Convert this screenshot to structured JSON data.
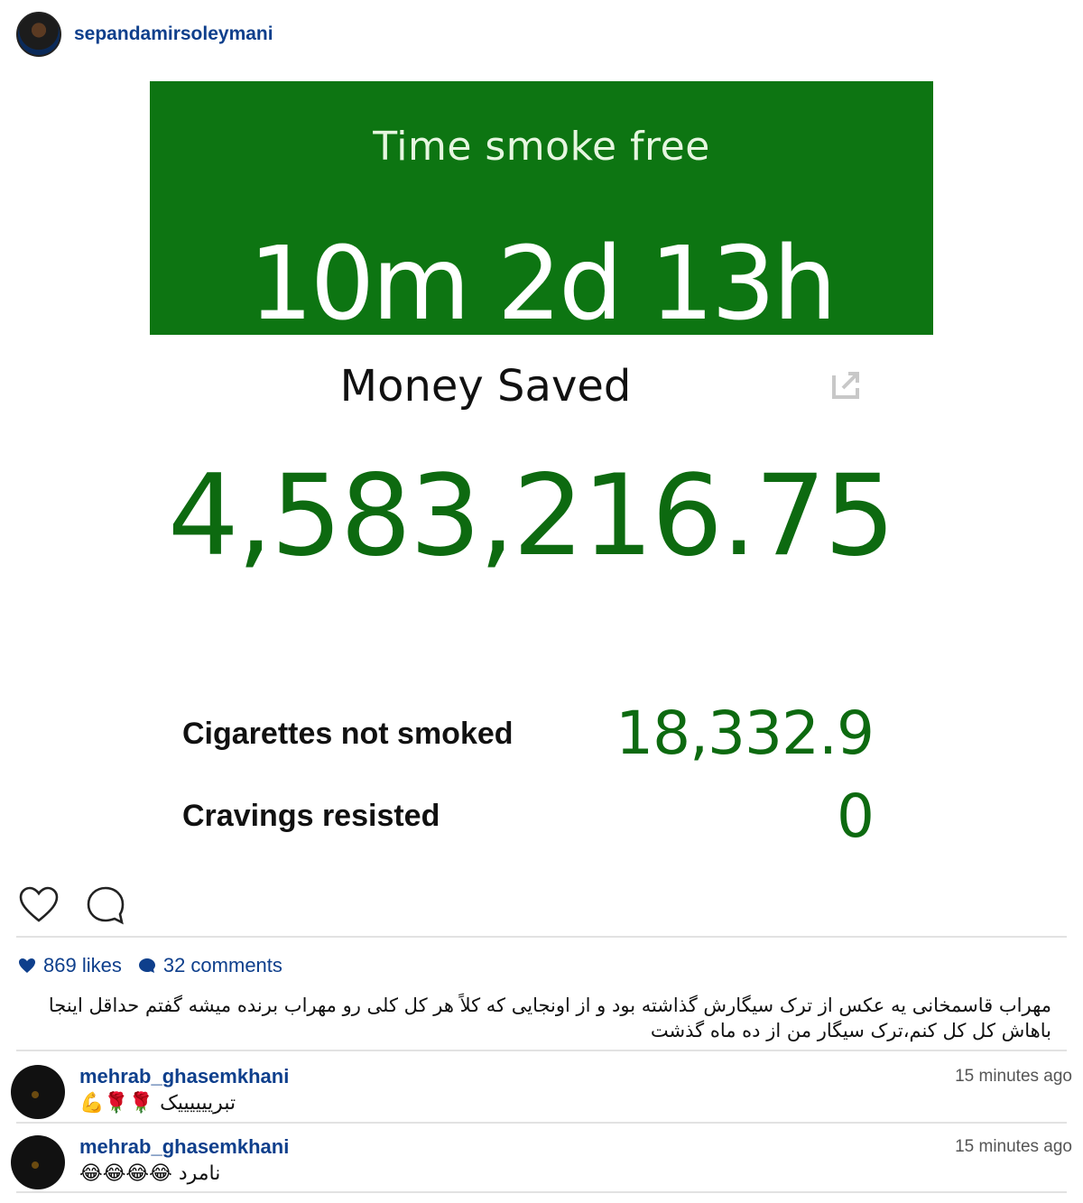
{
  "post": {
    "username": "sepandamirsoleymani"
  },
  "app": {
    "time_label": "Time smoke free",
    "time_value": "10m 2d 13h",
    "money_label": "Money Saved",
    "money_value": "4,583,216.75",
    "stats": [
      {
        "label": "Cigarettes not smoked",
        "value": "18,332.9"
      },
      {
        "label": "Cravings resisted",
        "value": "0"
      }
    ],
    "accent_color": "#0d7512"
  },
  "engagement": {
    "likes": "869 likes",
    "comments": "32 comments"
  },
  "caption": "مهراب قاسمخانی یه عکس از ترک سیگارش گذاشته بود و از اونجایی که کلاً هر کل کلی رو مهراب برنده میشه گفتم حداقل اینجا باهاش کل کل کنم،ترک سیگار من از ده ماه گذشت",
  "comments": [
    {
      "username": "mehrab_ghasemkhani",
      "time": "15 minutes ago",
      "text": "تبرییییییک 🌹🌹💪"
    },
    {
      "username": "mehrab_ghasemkhani",
      "time": "15 minutes ago",
      "text": "نامرد 😂😂😂😂"
    }
  ]
}
